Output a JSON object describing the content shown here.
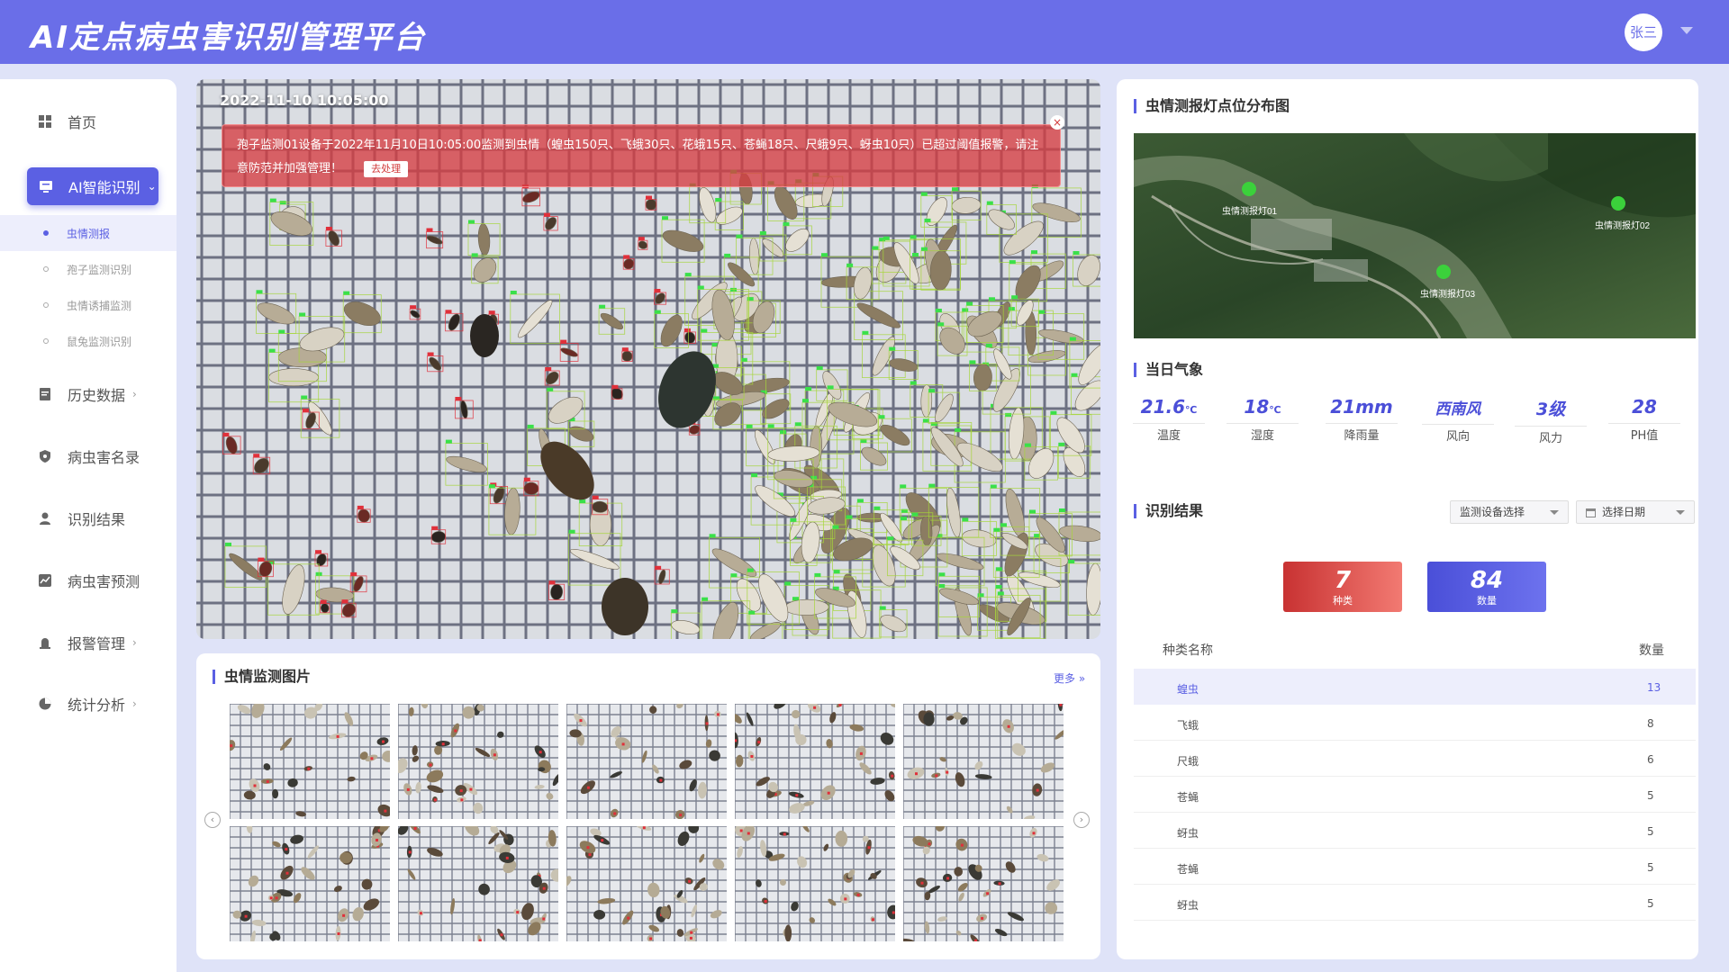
{
  "header": {
    "title": "AI定点病虫害识别管理平台",
    "user": "张三"
  },
  "sidebar": {
    "items": [
      {
        "label": "首页",
        "icon": "grid-icon"
      },
      {
        "label": "AI智能识别",
        "icon": "monitor-icon"
      },
      {
        "label": "历史数据",
        "icon": "document-icon"
      },
      {
        "label": "病虫害名录",
        "icon": "shield-icon"
      },
      {
        "label": "识别结果",
        "icon": "person-icon"
      },
      {
        "label": "病虫害预测",
        "icon": "trend-icon"
      },
      {
        "label": "报警管理",
        "icon": "alarm-icon"
      },
      {
        "label": "统计分析",
        "icon": "pie-icon"
      }
    ],
    "sub_items": [
      "虫情测报",
      "孢子监测识别",
      "虫情诱捕监测",
      "鼠兔监测识别"
    ]
  },
  "main_image": {
    "timestamp": "2022-11-10  10:05:00",
    "alert_text": "孢子监测01设备于2022年11月10日10:05:00监测到虫情（蝗虫150只、飞蛾30只、花蛾15只、苍蝇18只、尺蛾9只、蚜虫10只）已超过阈值报警，请注意防范并加强管理！",
    "alert_button": "去处理",
    "close_glyph": "×"
  },
  "gallery": {
    "title": "虫情监测图片",
    "more": "更多 »",
    "prev": "‹",
    "next": "›"
  },
  "map": {
    "title": "虫情测报灯点位分布图",
    "points": [
      "虫情测报灯01",
      "虫情测报灯02",
      "虫情测报灯03"
    ]
  },
  "weather": {
    "title": "当日气象",
    "items": [
      {
        "value": "21.6",
        "unit": "℃",
        "label": "温度"
      },
      {
        "value": "18",
        "unit": "℃",
        "label": "湿度"
      },
      {
        "value": "21mm",
        "unit": "",
        "label": "降雨量"
      },
      {
        "value": "西南风",
        "unit": "",
        "label": "风向"
      },
      {
        "value": "3级",
        "unit": "",
        "label": "风力"
      },
      {
        "value": "28",
        "unit": "",
        "label": "PH值"
      }
    ]
  },
  "results": {
    "title": "识别结果",
    "device_select": "监测设备选择",
    "date_select": "选择日期",
    "species_count": "7",
    "species_label": "种类",
    "total_count": "84",
    "total_label": "数量",
    "col_name": "种类名称",
    "col_count": "数量",
    "rows": [
      {
        "name": "蝗虫",
        "count": "13"
      },
      {
        "name": "飞蛾",
        "count": "8"
      },
      {
        "name": "尺蛾",
        "count": "6"
      },
      {
        "name": "苍蝇",
        "count": "5"
      },
      {
        "name": "蚜虫",
        "count": "5"
      },
      {
        "name": "苍蝇",
        "count": "5"
      },
      {
        "name": "蚜虫",
        "count": "5"
      }
    ]
  },
  "colors": {
    "accent": "#5b60e3",
    "header": "#6a6ee8",
    "alert": "#d63c41",
    "species_card": "#e0504e",
    "total_card": "#5459e0"
  }
}
